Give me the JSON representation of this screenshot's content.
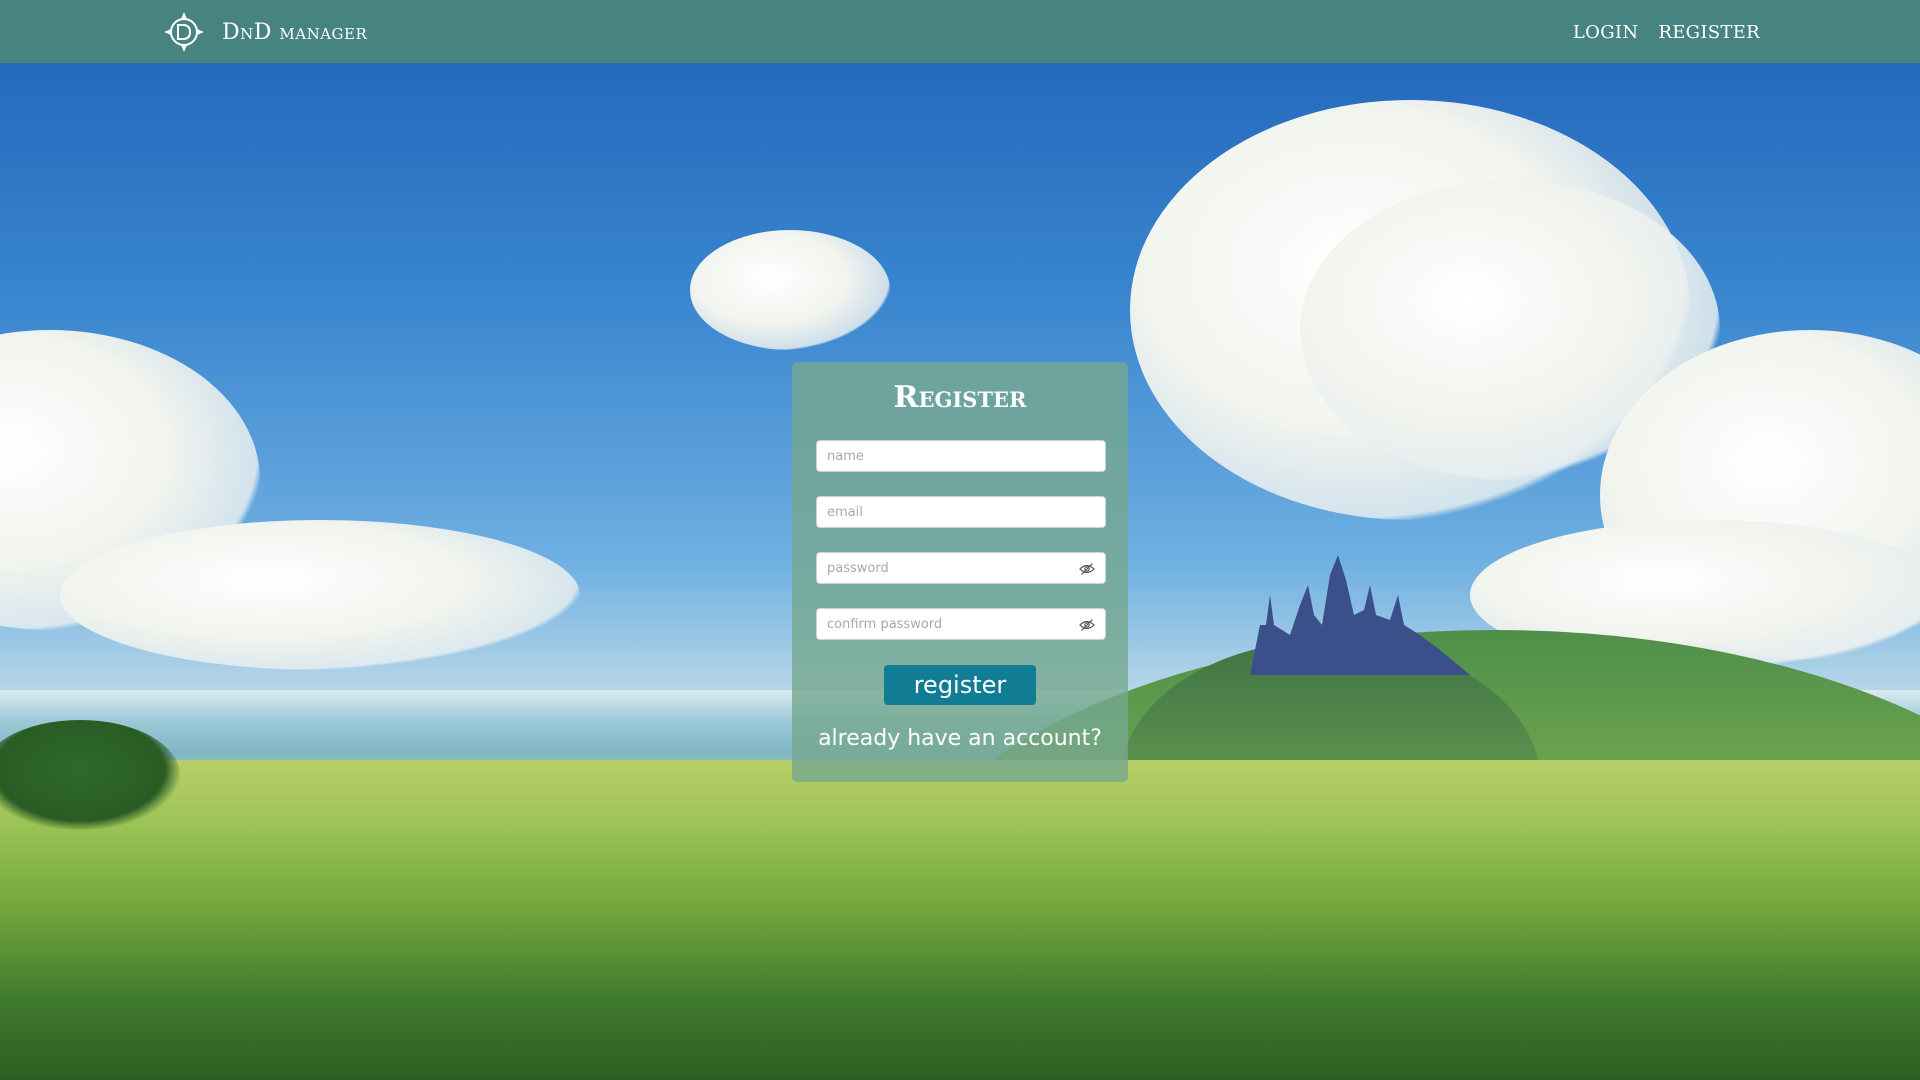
{
  "header": {
    "logo_icon": "d20-dragon-logo-icon",
    "brand_name": "DnD manager",
    "nav": {
      "login": "LOGIN",
      "register": "REGISTER"
    }
  },
  "register_form": {
    "title": "Register",
    "fields": {
      "name": {
        "placeholder": "name"
      },
      "email": {
        "placeholder": "email"
      },
      "password": {
        "placeholder": "password",
        "toggle_icon": "eye-slash-icon"
      },
      "confirm_password": {
        "placeholder": "confirm password",
        "toggle_icon": "eye-slash-icon"
      }
    },
    "submit_label": "register",
    "login_link": "already have an account?"
  },
  "colors": {
    "topbar": "#4a857c",
    "card": "#76a88f",
    "button": "#117d94",
    "text": "#ffffff"
  }
}
